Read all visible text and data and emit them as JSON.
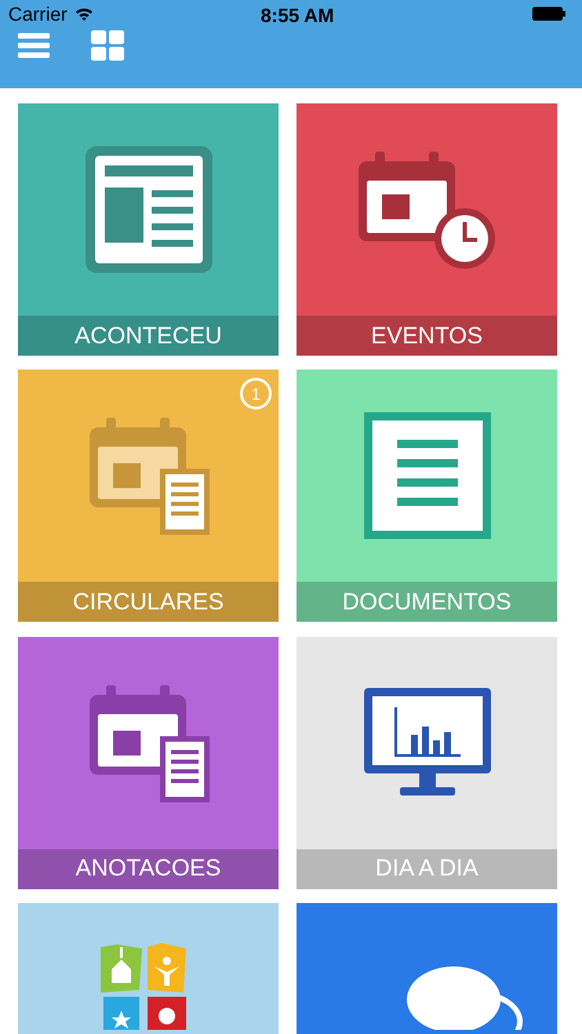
{
  "status_bar": {
    "carrier": "Carrier",
    "time": "8:55 AM"
  },
  "tiles": [
    {
      "kind": "news",
      "label": "ACONTECEU",
      "color": "#45b5aa"
    },
    {
      "kind": "event",
      "label": "EVENTOS",
      "color": "#e04b55"
    },
    {
      "kind": "circular",
      "label": "CIRCULARES",
      "color": "#f0b847",
      "badge": "1"
    },
    {
      "kind": "document",
      "label": "DOCUMENTOS",
      "color": "#7ee2ad"
    },
    {
      "kind": "notes",
      "label": "ANOTACOES",
      "color": "#b466d9"
    },
    {
      "kind": "daily",
      "label": "DIA A DIA",
      "color": "#e6e6e6"
    },
    {
      "kind": "logo",
      "color": "#a9d4ec"
    },
    {
      "kind": "chat",
      "color": "#2979e6"
    }
  ]
}
